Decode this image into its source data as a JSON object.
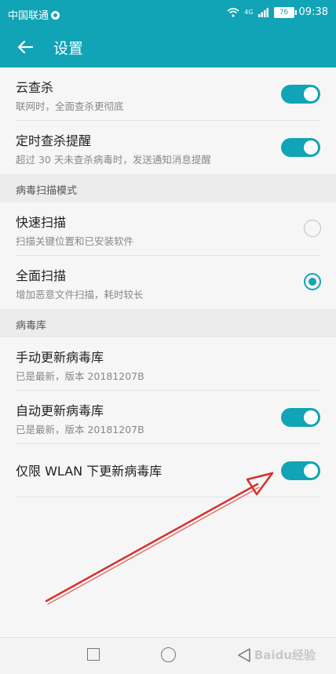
{
  "status": {
    "carrier": "中国联通",
    "signal": "4G",
    "battery": "76",
    "time": "09:38"
  },
  "appbar": {
    "title": "设置"
  },
  "items": {
    "cloud": {
      "title": "云查杀",
      "subtitle": "联网时，全面查杀更彻底"
    },
    "timer": {
      "title": "定时查杀提醒",
      "subtitle": "超过 30 天未查杀病毒时，发送通知消息提醒"
    }
  },
  "sections": {
    "scan_mode": "病毒扫描模式",
    "virus_db": "病毒库"
  },
  "scan": {
    "quick": {
      "title": "快速扫描",
      "subtitle": "扫描关键位置和已安装软件"
    },
    "full": {
      "title": "全面扫描",
      "subtitle": "增加恶意文件扫描，耗时较长"
    }
  },
  "db": {
    "manual": {
      "title": "手动更新病毒库",
      "subtitle": "已是最新，版本 20181207B"
    },
    "auto": {
      "title": "自动更新病毒库",
      "subtitle": "已是最新，版本 20181207B"
    },
    "wlan": {
      "title": "仅限 WLAN 下更新病毒库"
    }
  },
  "watermark": "Baidu经验",
  "colors": {
    "accent": "#11a3b6",
    "annotation": "#d9302c"
  }
}
